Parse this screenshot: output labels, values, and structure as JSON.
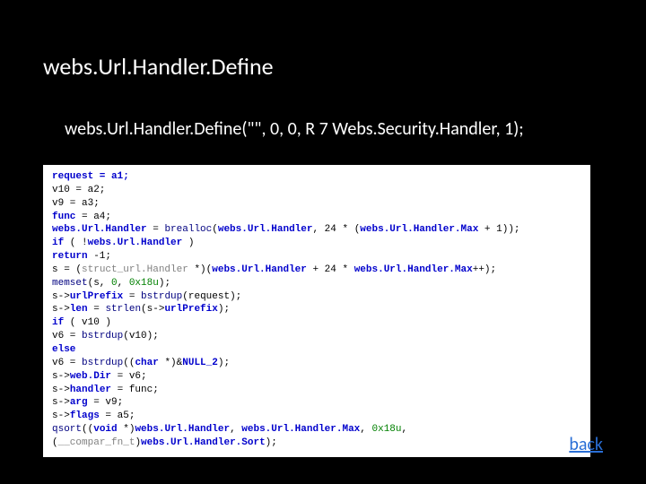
{
  "title": "webs.Url.Handler.Define",
  "subtitle": "webs.Url.Handler.Define(\"\", 0, 0, R 7 Webs.Security.Handler, 1);",
  "back": "back",
  "code": {
    "l1a": "request = a1;",
    "l2": "v10 = a2;",
    "l3": "v9 = a3;",
    "l4a": "func",
    "l4b": " = a4;",
    "l5a": "webs.Url.Handler",
    "l5b": " = ",
    "l5c": "brealloc",
    "l5d": "(",
    "l5e": "webs.Url.Handler",
    "l5f": ", 24 * (",
    "l5g": "webs.Url.Handler.Max",
    "l5h": " + 1));",
    "l6a": "if",
    "l6b": " ( !",
    "l6c": "webs.Url.Handler",
    "l6d": " )",
    "l7a": "    ",
    "l7b": "return",
    "l7c": " -1;",
    "l8a": "s = (",
    "l8b": "struct_url.Handler",
    "l8c": " *)(",
    "l8d": "webs.Url.Handler",
    "l8e": " + 24 * ",
    "l8f": "webs.Url.Handler.Max",
    "l8g": "++);",
    "l9a": "memset",
    "l9b": "(s, ",
    "l9c": "0",
    "l9d": ", ",
    "l9e": "0x18u",
    "l9f": ");",
    "l10a": "s->",
    "l10b": "urlPrefix",
    "l10c": " = ",
    "l10d": "bstrdup",
    "l10e": "(request);",
    "l11a": "s->",
    "l11b": "len",
    "l11c": " = ",
    "l11d": "strlen",
    "l11e": "(s->",
    "l11f": "urlPrefix",
    "l11g": ");",
    "l12a": "if",
    "l12b": " ( v10 )",
    "l13a": "    v6 = ",
    "l13b": "bstrdup",
    "l13c": "(v10);",
    "l14a": "else",
    "l15a": "    v6 = ",
    "l15b": "bstrdup",
    "l15c": "((",
    "l15d": "char",
    "l15e": " *)&",
    "l15f": "NULL_2",
    "l15g": ");",
    "l16a": "s->",
    "l16b": "web.Dir",
    "l16c": " = v6;",
    "l17a": "s->",
    "l17b": "handler",
    "l17c": " = func;",
    "l18a": "s->",
    "l18b": "arg",
    "l18c": " = v9;",
    "l19a": "s->",
    "l19b": "flags",
    "l19c": " = a5;",
    "l20a": "qsort",
    "l20b": "((",
    "l20c": "void",
    "l20d": " *)",
    "l20e": "webs.Url.Handler",
    "l20f": ", ",
    "l20g": "webs.Url.Handler.Max",
    "l20h": ", ",
    "l20i": "0x18u",
    "l20j": ", (",
    "l20k": "__compar_fn_t",
    "l20l": ")",
    "l20m": "webs.Url.Handler.Sort",
    "l20n": ");"
  }
}
